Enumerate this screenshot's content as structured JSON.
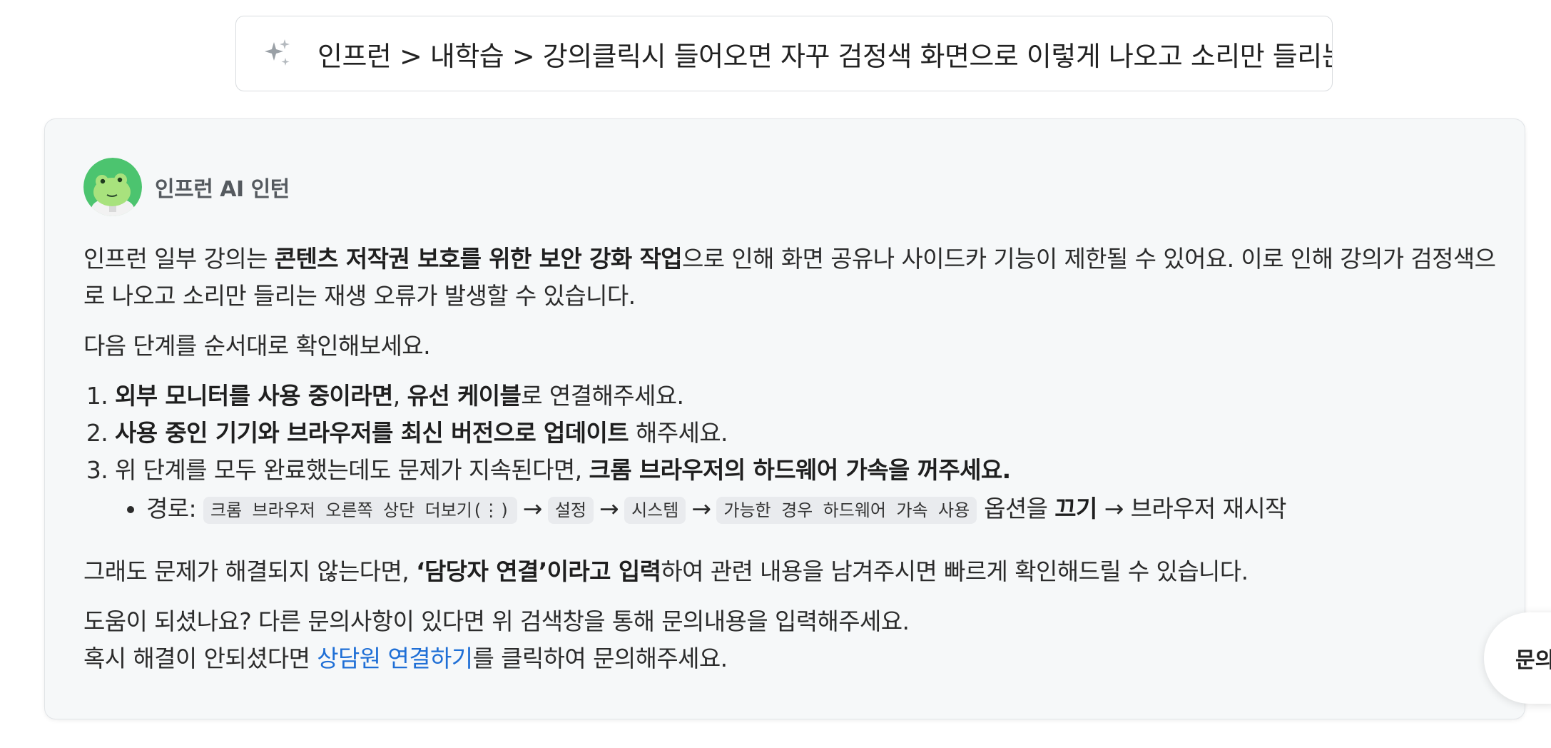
{
  "search": {
    "icon": "sparkle-icon",
    "query": "인프런 > 내학습 > 강의클릭시 들어오면 자꾸 검정색 화면으로 이렇게 나오고 소리만 들리는"
  },
  "bot": {
    "name": "인프런 AI 인턴",
    "avatar_icon": "frog-mascot-avatar"
  },
  "answer": {
    "intro": {
      "pre": "인프런 일부 강의는 ",
      "bold": "콘텐츠 저작권 보호를 위한 보안 강화 작업",
      "post": "으로 인해 화면 공유나 사이드카 기능이 제한될 수 있어요. 이로 인해 강의가 검정색으로 나오고 소리만 들리는 재생 오류가 발생할 수 있습니다."
    },
    "steps_intro": "다음 단계를 순서대로 확인해보세요.",
    "steps": [
      {
        "bold1": "외부 모니터를 사용 중이라면",
        "mid": ", ",
        "bold2": "유선 케이블",
        "post": "로 연결해주세요."
      },
      {
        "bold1": "사용 중인 기기와 브라우저를 최신 버전으로 업데이트",
        "post": " 해주세요."
      },
      {
        "pre": "위 단계를 모두 완료했는데도 문제가 지속된다면, ",
        "bold1": "크롬 브라우저의 하드웨어 가속을 꺼주세요."
      }
    ],
    "path": {
      "label": "경로: ",
      "chips": [
        "크롬 브라우저 오른쪽 상단 더보기(⋮)",
        "설정",
        "시스템",
        "가능한 경우 하드웨어 가속 사용"
      ],
      "arrow": "→",
      "option_text": " 옵션을 ",
      "off_bold": "끄기",
      "restart": " → 브라우저 재시작"
    },
    "fallback": {
      "pre": "그래도 문제가 해결되지 않는다면, ",
      "bold": "‘담당자 연결’이라고 입력",
      "post": "하여 관련 내용을 남겨주시면 빠르게 확인해드릴 수 있습니다."
    },
    "help_line": "도움이 되셨나요? 다른 문의사항이 있다면 위 검색창을 통해 문의내용을 입력해주세요.",
    "contact": {
      "pre": "혹시 해결이 안되셨다면 ",
      "link": "상담원 연결하기",
      "post": "를 클릭하여 문의해주세요."
    }
  },
  "float_button": {
    "label": "문의"
  }
}
